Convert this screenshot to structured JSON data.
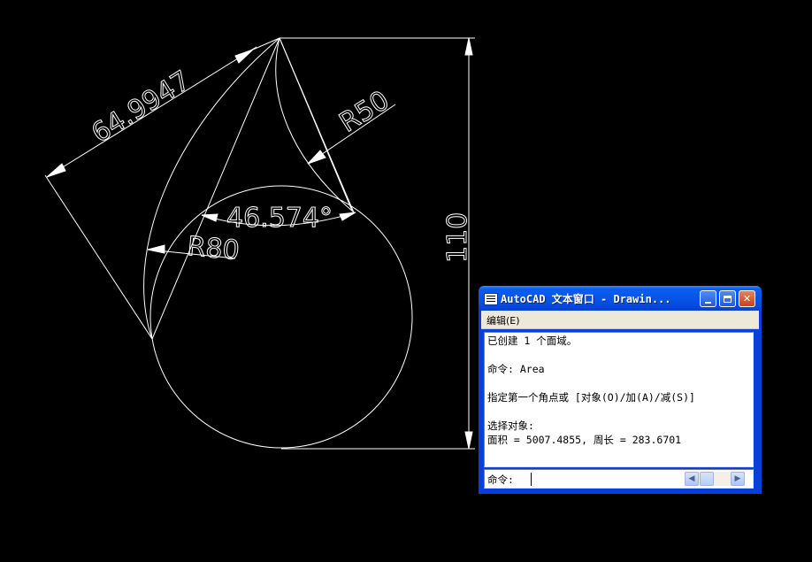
{
  "drawing": {
    "dimensions": {
      "aligned": "64.9947",
      "angle": "46.574°",
      "radius_large": "R80",
      "radius_small": "R50",
      "vertical": "110"
    },
    "colors": {
      "background": "#000000",
      "geometry": "#ffffff"
    }
  },
  "text_window": {
    "title": "AutoCAD 文本窗口 - Drawin...",
    "icon": "text-window-icon",
    "menu": {
      "edit": "编辑(E)"
    },
    "output_lines": [
      "已创建 1 个面域。",
      "",
      "命令: Area",
      "",
      "指定第一个角点或 [对象(O)/加(A)/减(S)]",
      "",
      "选择对象:",
      "面积 = 5007.4855, 周长 = 283.6701"
    ],
    "command_label": "命令:",
    "command_value": ""
  }
}
